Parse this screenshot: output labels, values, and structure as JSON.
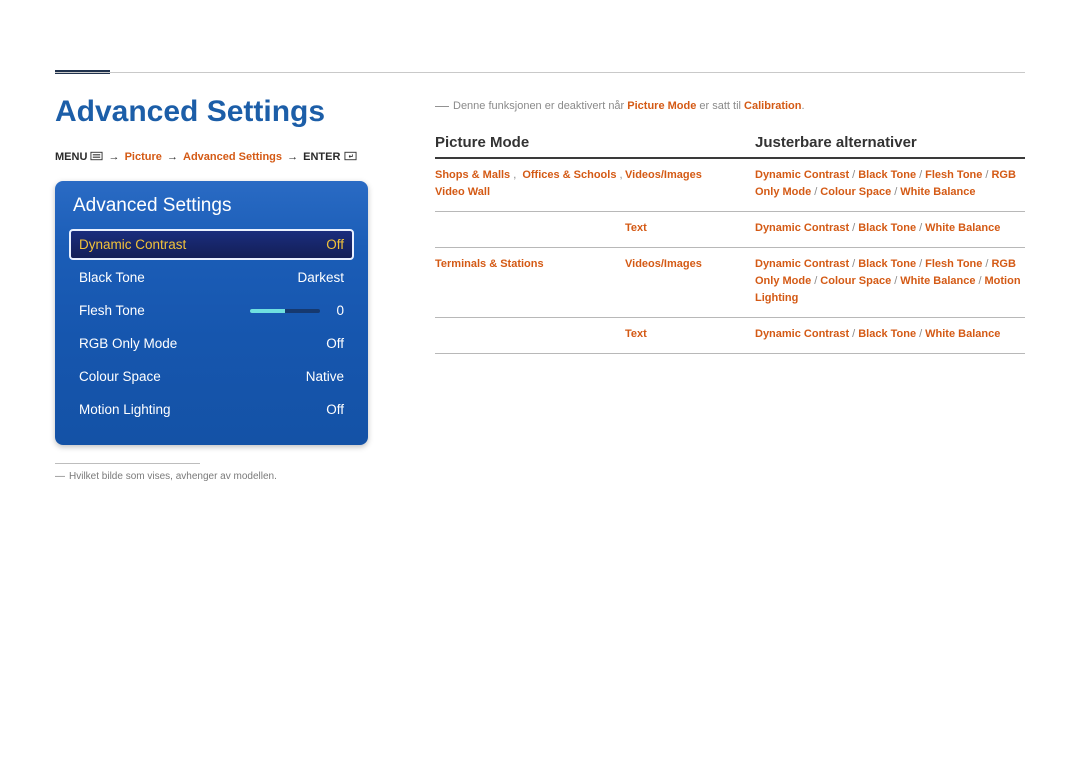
{
  "heading": "Advanced Settings",
  "breadcrumb": {
    "menu": "MENU",
    "arrow": "→",
    "picture": "Picture",
    "advanced": "Advanced Settings",
    "enter": "ENTER"
  },
  "osd": {
    "title": "Advanced Settings",
    "rows": [
      {
        "label": "Dynamic Contrast",
        "value": "Off",
        "selected": true,
        "type": "text"
      },
      {
        "label": "Black Tone",
        "value": "Darkest",
        "type": "text"
      },
      {
        "label": "Flesh Tone",
        "value": "0",
        "type": "slider"
      },
      {
        "label": "RGB Only Mode",
        "value": "Off",
        "type": "text"
      },
      {
        "label": "Colour Space",
        "value": "Native",
        "type": "text"
      },
      {
        "label": "Motion Lighting",
        "value": "Off",
        "type": "text"
      }
    ]
  },
  "footnote": {
    "dash": "―",
    "text": "Hvilket bilde som vises, avhenger av modellen."
  },
  "note": {
    "dash": "―",
    "pre": "Denne funksjonen er deaktivert når ",
    "hl1": "Picture Mode",
    "mid": " er satt til ",
    "hl2": "Calibration",
    "end": "."
  },
  "tableHeaders": {
    "col1": "Picture Mode",
    "col2": "",
    "col3": "Justerbare alternativer"
  },
  "tableRows": [
    {
      "col1_parts": [
        "Shops & Malls",
        ", ",
        "Offices & Schools",
        ", ",
        "Video Wall"
      ],
      "col2": "Videos/Images",
      "col3_parts": [
        "Dynamic Contrast",
        "Black Tone",
        "Flesh Tone",
        "RGB Only Mode",
        "Colour Space",
        "White Balance"
      ]
    },
    {
      "col1_parts": [],
      "col2": "Text",
      "col3_parts": [
        "Dynamic Contrast",
        "Black Tone",
        "White Balance"
      ]
    },
    {
      "col1_parts": [
        "Terminals & Stations"
      ],
      "col2": "Videos/Images",
      "col3_parts": [
        "Dynamic Contrast",
        "Black Tone",
        "Flesh Tone",
        "RGB Only Mode",
        "Colour Space",
        "White Balance",
        "Motion Lighting"
      ]
    },
    {
      "col1_parts": [],
      "col2": "Text",
      "col3_parts": [
        "Dynamic Contrast",
        "Black Tone",
        "White Balance"
      ]
    }
  ]
}
